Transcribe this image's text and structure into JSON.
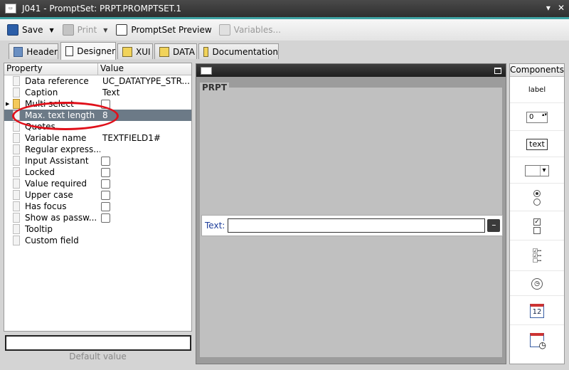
{
  "window": {
    "title": "J041 - PromptSet: PRPT.PROMPTSET.1",
    "minimize": "▾",
    "close": "✕"
  },
  "toolbar": {
    "save": "Save",
    "print": "Print",
    "preview": "PromptSet Preview",
    "variables": "Variables..."
  },
  "tabs": [
    "Header",
    "Designer",
    "XUI",
    "DATA",
    "Documentation"
  ],
  "properties": {
    "col_property": "Property",
    "col_value": "Value",
    "rows": [
      {
        "name": "Data reference",
        "value": "UC_DATATYPE_STR..."
      },
      {
        "name": "Caption",
        "value": "Text"
      },
      {
        "name": "Multi select",
        "value": ""
      },
      {
        "name": "Max. text length",
        "value": "8"
      },
      {
        "name": "Quotes",
        "value": ""
      },
      {
        "name": "Variable name",
        "value": "TEXTFIELD1#"
      },
      {
        "name": "Regular express...",
        "value": ""
      },
      {
        "name": "Input Assistant",
        "value": ""
      },
      {
        "name": "Locked",
        "value": ""
      },
      {
        "name": "Value required",
        "value": ""
      },
      {
        "name": "Upper case",
        "value": ""
      },
      {
        "name": "Has focus",
        "value": ""
      },
      {
        "name": "Show as passw...",
        "value": ""
      },
      {
        "name": "Tooltip",
        "value": ""
      },
      {
        "name": "Custom field",
        "value": ""
      }
    ],
    "default_value_label": "Default value"
  },
  "designer": {
    "legend": "PRPT",
    "field_label": "Text:",
    "field_button": "–"
  },
  "components": {
    "header": "Components",
    "label_text": "label",
    "spinner_value": "0",
    "text_text": "text",
    "calendar_day": "12"
  }
}
